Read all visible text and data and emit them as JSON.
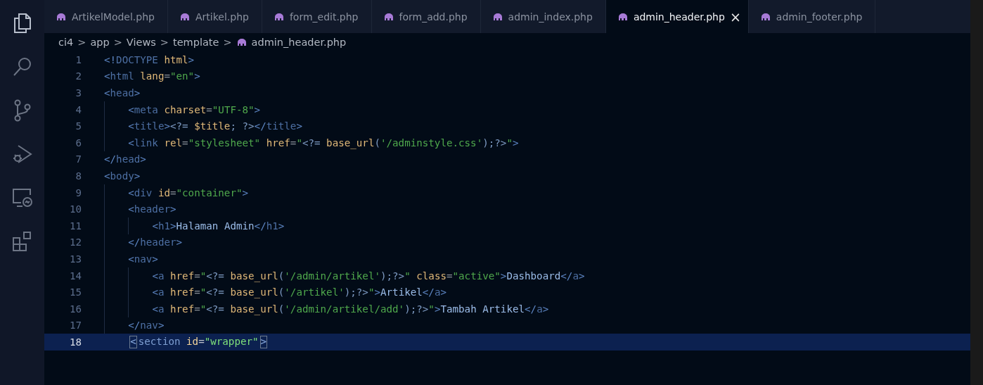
{
  "activity_bar": [
    {
      "kind": "files",
      "selected": true
    },
    {
      "kind": "search",
      "selected": false
    },
    {
      "kind": "source-control",
      "selected": false
    },
    {
      "kind": "run-debug",
      "selected": false
    },
    {
      "kind": "remote",
      "selected": false
    },
    {
      "kind": "extensions",
      "selected": false
    }
  ],
  "tabs": [
    {
      "label": "ArtikelModel.php",
      "selected": false
    },
    {
      "label": "Artikel.php",
      "selected": false
    },
    {
      "label": "form_edit.php",
      "selected": false
    },
    {
      "label": "form_add.php",
      "selected": false
    },
    {
      "label": "admin_index.php",
      "selected": false
    },
    {
      "label": "admin_header.php",
      "selected": true,
      "close": "×"
    },
    {
      "label": "admin_footer.php",
      "selected": false
    }
  ],
  "breadcrumb": [
    "ci4",
    "app",
    "Views",
    "template",
    "admin_header.php"
  ],
  "breadcrumb_separator": ">",
  "lines": [
    {
      "number": "1",
      "current": false,
      "tokens": [
        {
          "kind": "punct",
          "text": "<!"
        },
        {
          "kind": "tag",
          "text": "DOCTYPE"
        },
        {
          "kind": "attr",
          "text": " html"
        },
        {
          "kind": "punct",
          "text": ">"
        }
      ]
    },
    {
      "number": "2",
      "current": false,
      "tokens": [
        {
          "kind": "punct",
          "text": "<"
        },
        {
          "kind": "tag",
          "text": "html"
        },
        {
          "kind": "attr",
          "text": " lang"
        },
        {
          "kind": "op",
          "text": "="
        },
        {
          "kind": "string",
          "text": "\"en\""
        },
        {
          "kind": "punct",
          "text": ">"
        }
      ]
    },
    {
      "number": "3",
      "current": false,
      "tokens": [
        {
          "kind": "punct",
          "text": "<"
        },
        {
          "kind": "tag",
          "text": "head"
        },
        {
          "kind": "punct",
          "text": ">"
        }
      ],
      "children": [
        {
          "number": "4",
          "current": false,
          "tokens": [
            {
              "kind": "punct",
              "text": "<"
            },
            {
              "kind": "tag",
              "text": "meta"
            },
            {
              "kind": "attr",
              "text": " charset"
            },
            {
              "kind": "op",
              "text": "="
            },
            {
              "kind": "string",
              "text": "\"UTF-8\""
            },
            {
              "kind": "punct",
              "text": ">"
            }
          ]
        },
        {
          "number": "5",
          "current": false,
          "tokens": [
            {
              "kind": "punct",
              "text": "<"
            },
            {
              "kind": "tag",
              "text": "title"
            },
            {
              "kind": "punct",
              "text": ">"
            },
            {
              "kind": "php",
              "text": "<?="
            },
            {
              "kind": "attr",
              "text": " $title"
            },
            {
              "kind": "php",
              "text": "; ?>"
            },
            {
              "kind": "punct",
              "text": "</"
            },
            {
              "kind": "tag",
              "text": "title"
            },
            {
              "kind": "punct",
              "text": ">"
            }
          ]
        },
        {
          "number": "6",
          "current": false,
          "tokens": [
            {
              "kind": "punct",
              "text": "<"
            },
            {
              "kind": "tag",
              "text": "link"
            },
            {
              "kind": "attr",
              "text": " rel"
            },
            {
              "kind": "op",
              "text": "="
            },
            {
              "kind": "string",
              "text": "\"stylesheet\""
            },
            {
              "kind": "attr",
              "text": " href"
            },
            {
              "kind": "op",
              "text": "="
            },
            {
              "kind": "string",
              "text": "\""
            },
            {
              "kind": "php",
              "text": "<?="
            },
            {
              "kind": "attr",
              "text": " base_url"
            },
            {
              "kind": "php",
              "text": "("
            },
            {
              "kind": "string",
              "text": "'/adminstyle.css'"
            },
            {
              "kind": "php",
              "text": ");?>"
            },
            {
              "kind": "string",
              "text": "\""
            },
            {
              "kind": "punct",
              "text": ">"
            }
          ]
        }
      ]
    },
    {
      "number": "7",
      "current": false,
      "tokens": [
        {
          "kind": "punct",
          "text": "</"
        },
        {
          "kind": "tag",
          "text": "head"
        },
        {
          "kind": "punct",
          "text": ">"
        }
      ]
    },
    {
      "number": "8",
      "current": false,
      "tokens": [
        {
          "kind": "punct",
          "text": "<"
        },
        {
          "kind": "tag",
          "text": "body"
        },
        {
          "kind": "punct",
          "text": ">"
        }
      ],
      "children": [
        {
          "number": "9",
          "current": false,
          "tokens": [
            {
              "kind": "punct",
              "text": "<"
            },
            {
              "kind": "tag",
              "text": "div"
            },
            {
              "kind": "attr",
              "text": " id"
            },
            {
              "kind": "op",
              "text": "="
            },
            {
              "kind": "string",
              "text": "\"container\""
            },
            {
              "kind": "punct",
              "text": ">"
            }
          ]
        },
        {
          "number": "10",
          "current": false,
          "tokens": [
            {
              "kind": "punct",
              "text": "<"
            },
            {
              "kind": "tag",
              "text": "header"
            },
            {
              "kind": "punct",
              "text": ">"
            }
          ],
          "children": [
            {
              "number": "11",
              "current": false,
              "tokens": [
                {
                  "kind": "punct",
                  "text": "<"
                },
                {
                  "kind": "tag",
                  "text": "h1"
                },
                {
                  "kind": "punct",
                  "text": ">"
                },
                {
                  "kind": "text",
                  "text": "Halaman Admin"
                },
                {
                  "kind": "punct",
                  "text": "</"
                },
                {
                  "kind": "tag",
                  "text": "h1"
                },
                {
                  "kind": "punct",
                  "text": ">"
                }
              ]
            }
          ]
        },
        {
          "number": "12",
          "current": false,
          "tokens": [
            {
              "kind": "punct",
              "text": "</"
            },
            {
              "kind": "tag",
              "text": "header"
            },
            {
              "kind": "punct",
              "text": ">"
            }
          ]
        },
        {
          "number": "13",
          "current": false,
          "tokens": [
            {
              "kind": "punct",
              "text": "<"
            },
            {
              "kind": "tag",
              "text": "nav"
            },
            {
              "kind": "punct",
              "text": ">"
            }
          ],
          "children": [
            {
              "number": "14",
              "current": false,
              "tokens": [
                {
                  "kind": "punct",
                  "text": "<"
                },
                {
                  "kind": "tag",
                  "text": "a"
                },
                {
                  "kind": "attr",
                  "text": " href"
                },
                {
                  "kind": "op",
                  "text": "="
                },
                {
                  "kind": "string",
                  "text": "\""
                },
                {
                  "kind": "php",
                  "text": "<?="
                },
                {
                  "kind": "attr",
                  "text": " base_url"
                },
                {
                  "kind": "php",
                  "text": "("
                },
                {
                  "kind": "string",
                  "text": "'/admin/artikel'"
                },
                {
                  "kind": "php",
                  "text": ");?>"
                },
                {
                  "kind": "string",
                  "text": "\""
                },
                {
                  "kind": "attr",
                  "text": " class"
                },
                {
                  "kind": "op",
                  "text": "="
                },
                {
                  "kind": "string",
                  "text": "\"active\""
                },
                {
                  "kind": "punct",
                  "text": ">"
                },
                {
                  "kind": "text",
                  "text": "Dashboard"
                },
                {
                  "kind": "punct",
                  "text": "</"
                },
                {
                  "kind": "tag",
                  "text": "a"
                },
                {
                  "kind": "punct",
                  "text": ">"
                }
              ]
            },
            {
              "number": "15",
              "current": false,
              "tokens": [
                {
                  "kind": "punct",
                  "text": "<"
                },
                {
                  "kind": "tag",
                  "text": "a"
                },
                {
                  "kind": "attr",
                  "text": " href"
                },
                {
                  "kind": "op",
                  "text": "="
                },
                {
                  "kind": "string",
                  "text": "\""
                },
                {
                  "kind": "php",
                  "text": "<?="
                },
                {
                  "kind": "attr",
                  "text": " base_url"
                },
                {
                  "kind": "php",
                  "text": "("
                },
                {
                  "kind": "string",
                  "text": "'/artikel'"
                },
                {
                  "kind": "php",
                  "text": ");?>"
                },
                {
                  "kind": "string",
                  "text": "\""
                },
                {
                  "kind": "punct",
                  "text": ">"
                },
                {
                  "kind": "text",
                  "text": "Artikel"
                },
                {
                  "kind": "punct",
                  "text": "</"
                },
                {
                  "kind": "tag",
                  "text": "a"
                },
                {
                  "kind": "punct",
                  "text": ">"
                }
              ]
            },
            {
              "number": "16",
              "current": false,
              "tokens": [
                {
                  "kind": "punct",
                  "text": "<"
                },
                {
                  "kind": "tag",
                  "text": "a"
                },
                {
                  "kind": "attr",
                  "text": " href"
                },
                {
                  "kind": "op",
                  "text": "="
                },
                {
                  "kind": "string",
                  "text": "\""
                },
                {
                  "kind": "php",
                  "text": "<?="
                },
                {
                  "kind": "attr",
                  "text": " base_url"
                },
                {
                  "kind": "php",
                  "text": "("
                },
                {
                  "kind": "string",
                  "text": "'/admin/artikel/add'"
                },
                {
                  "kind": "php",
                  "text": ");?>"
                },
                {
                  "kind": "string",
                  "text": "\""
                },
                {
                  "kind": "punct",
                  "text": ">"
                },
                {
                  "kind": "text",
                  "text": "Tambah Artikel"
                },
                {
                  "kind": "punct",
                  "text": "</"
                },
                {
                  "kind": "tag",
                  "text": "a"
                },
                {
                  "kind": "punct",
                  "text": ">"
                }
              ]
            }
          ]
        },
        {
          "number": "17",
          "current": false,
          "tokens": [
            {
              "kind": "punct",
              "text": "</"
            },
            {
              "kind": "tag",
              "text": "nav"
            },
            {
              "kind": "punct",
              "text": ">"
            }
          ]
        },
        {
          "number": "18",
          "current": true,
          "tokens": [
            {
              "kind": "bracket",
              "text": "<"
            },
            {
              "kind": "tag",
              "text": "section"
            },
            {
              "kind": "attr",
              "text": " id"
            },
            {
              "kind": "op",
              "text": "="
            },
            {
              "kind": "string",
              "text": "\"wrapper\""
            },
            {
              "kind": "bracket",
              "text": ">"
            }
          ]
        }
      ]
    }
  ]
}
